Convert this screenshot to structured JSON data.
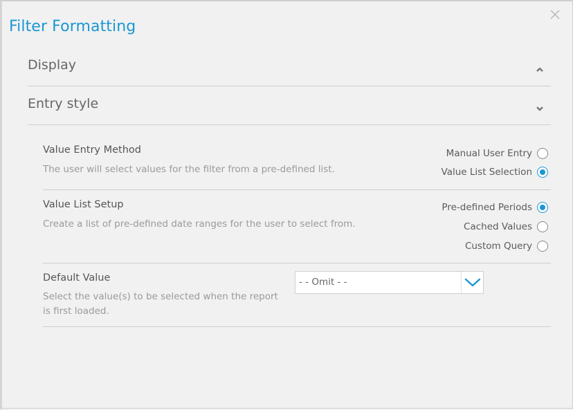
{
  "dialog": {
    "title": "Filter Formatting",
    "close_icon": "close-icon",
    "accent_color": "#1a97d2"
  },
  "sections": [
    {
      "label": "Display",
      "state": "expanded",
      "icon": "chevron-up-icon"
    },
    {
      "label": "Entry style",
      "state": "collapsed",
      "icon": "chevron-down-icon"
    }
  ],
  "value_entry_method": {
    "title": "Value Entry Method",
    "description": "The user will select values for the filter from a pre-defined list.",
    "options": [
      {
        "label": "Manual User Entry",
        "checked": false
      },
      {
        "label": "Value List Selection",
        "checked": true
      }
    ]
  },
  "value_list_setup": {
    "title": "Value List Setup",
    "description": "Create a list of pre-defined date ranges for the user to select from.",
    "options": [
      {
        "label": "Pre-defined Periods",
        "checked": true
      },
      {
        "label": "Cached Values",
        "checked": false
      },
      {
        "label": "Custom Query",
        "checked": false
      }
    ]
  },
  "default_value": {
    "title": "Default Value",
    "description": "Select the value(s) to be selected when the report is first loaded.",
    "selected": "- - Omit - -",
    "dropdown_icon": "chevron-down-icon"
  }
}
